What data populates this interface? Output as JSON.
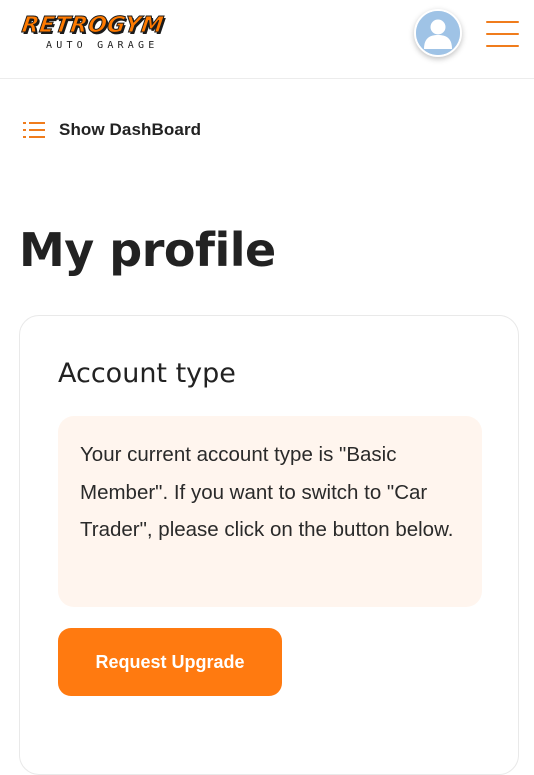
{
  "header": {
    "logo_main": "RETROGYM",
    "logo_sub": "AUTO GARAGE",
    "avatar_icon": "user-avatar-icon",
    "menu_icon": "hamburger-menu-icon"
  },
  "dashboard_toggle": {
    "icon": "list-icon",
    "label": "Show DashBoard"
  },
  "page": {
    "title": "My profile"
  },
  "account_card": {
    "title": "Account type",
    "notice": "Your current account type is \"Basic Member\". If you want to switch to \"Car Trader\", please click on the button below.",
    "button_label": "Request Upgrade"
  },
  "colors": {
    "accent": "#ff7a10",
    "notice_background": "#fff5ee",
    "avatar_background": "#9fc3e6"
  }
}
